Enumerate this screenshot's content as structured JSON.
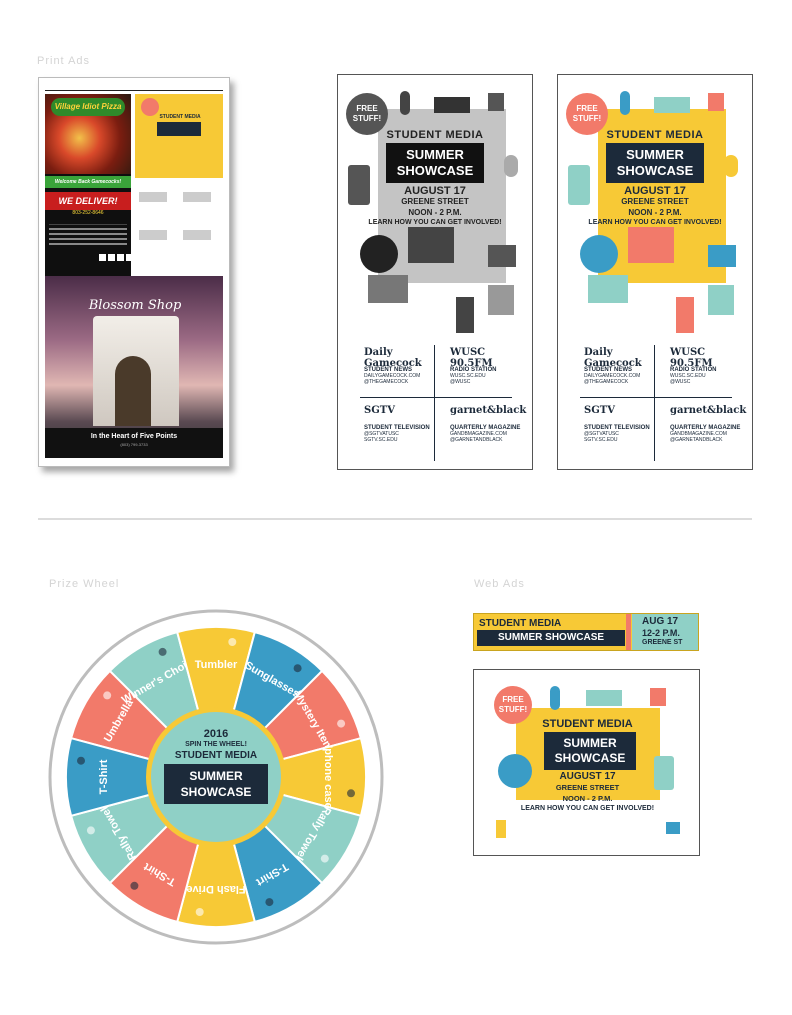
{
  "sections": {
    "print_ads": "Print Ads",
    "prize_wheel": "Prize Wheel",
    "web_ads": "Web Ads"
  },
  "colors": {
    "yellow": "#f7c936",
    "teal": "#8fd0c6",
    "coral": "#f27a6a",
    "navy": "#1c2a3a",
    "blue": "#3a9cc6",
    "gray": "#bdbdbd"
  },
  "newspaper": {
    "pizza_logo": "Village Idiot Pizza",
    "welcome": "Welcome Back Gamecocks!",
    "deliver": "WE DELIVER!",
    "phone": "803-252-8646",
    "points": "FIVE POINTS | FOREST ACRES OLYMPIA @ THE MILLS",
    "boutique_sign": "Blossom Shop",
    "boutique_tag": "In the Heart of Five Points",
    "boutique_phone": "(803) 799-3733"
  },
  "poster": {
    "free": "FREE STUFF!",
    "student_media": "STUDENT MEDIA",
    "title_line1": "SUMMER",
    "title_line2": "SHOWCASE",
    "date": "AUGUST 17",
    "street": "GREENE STREET",
    "time": "NOON - 2 P.M.",
    "learn": "LEARN HOW YOU CAN GET INVOLVED!",
    "outlets": [
      {
        "logo": "Daily Gamecock",
        "name": "STUDENT NEWS",
        "line1": "DAILYGAMECOCK.COM",
        "line2": "@THEGAMECOCK"
      },
      {
        "logo": "WUSC 90.5FM",
        "name": "RADIO STATION",
        "line1": "WUSC.SC.EDU",
        "line2": "@WUSC"
      },
      {
        "logo": "SGTV",
        "name": "STUDENT TELEVISION",
        "line1": "@SGTVATUSC",
        "line2": "SGTV.SC.EDU"
      },
      {
        "logo": "garnet&black",
        "name": "QUARTERLY MAGAZINE",
        "line1": "GANDBMAGAZINE.COM",
        "line2": "@GARNETANDBLACK"
      }
    ]
  },
  "wheel": {
    "year": "2016",
    "spin": "SPIN THE WHEEL!",
    "student_media": "STUDENT MEDIA",
    "title_line1": "SUMMER",
    "title_line2": "SHOWCASE",
    "segments": [
      {
        "label": "Umbrella",
        "color": "#f27a6a"
      },
      {
        "label": "Winner's Choice",
        "color": "#8fd0c6"
      },
      {
        "label": "Tumbler",
        "color": "#f7c936"
      },
      {
        "label": "Sunglasses",
        "color": "#3a9cc6"
      },
      {
        "label": "Mystery Item",
        "color": "#f27a6a"
      },
      {
        "label": "Iphone case",
        "color": "#f7c936"
      },
      {
        "label": "Rally Towel",
        "color": "#8fd0c6"
      },
      {
        "label": "T-Shirt",
        "color": "#3a9cc6"
      },
      {
        "label": "Flash Drive",
        "color": "#f7c936"
      },
      {
        "label": "T-Shirt",
        "color": "#f27a6a"
      },
      {
        "label": "Rally Towel",
        "color": "#8fd0c6"
      },
      {
        "label": "T-Shirt",
        "color": "#3a9cc6"
      }
    ]
  },
  "banner": {
    "student_media": "STUDENT MEDIA",
    "title": "SUMMER SHOWCASE",
    "date": "AUG 17",
    "time": "12-2 P.M.",
    "street": "GREENE ST"
  }
}
